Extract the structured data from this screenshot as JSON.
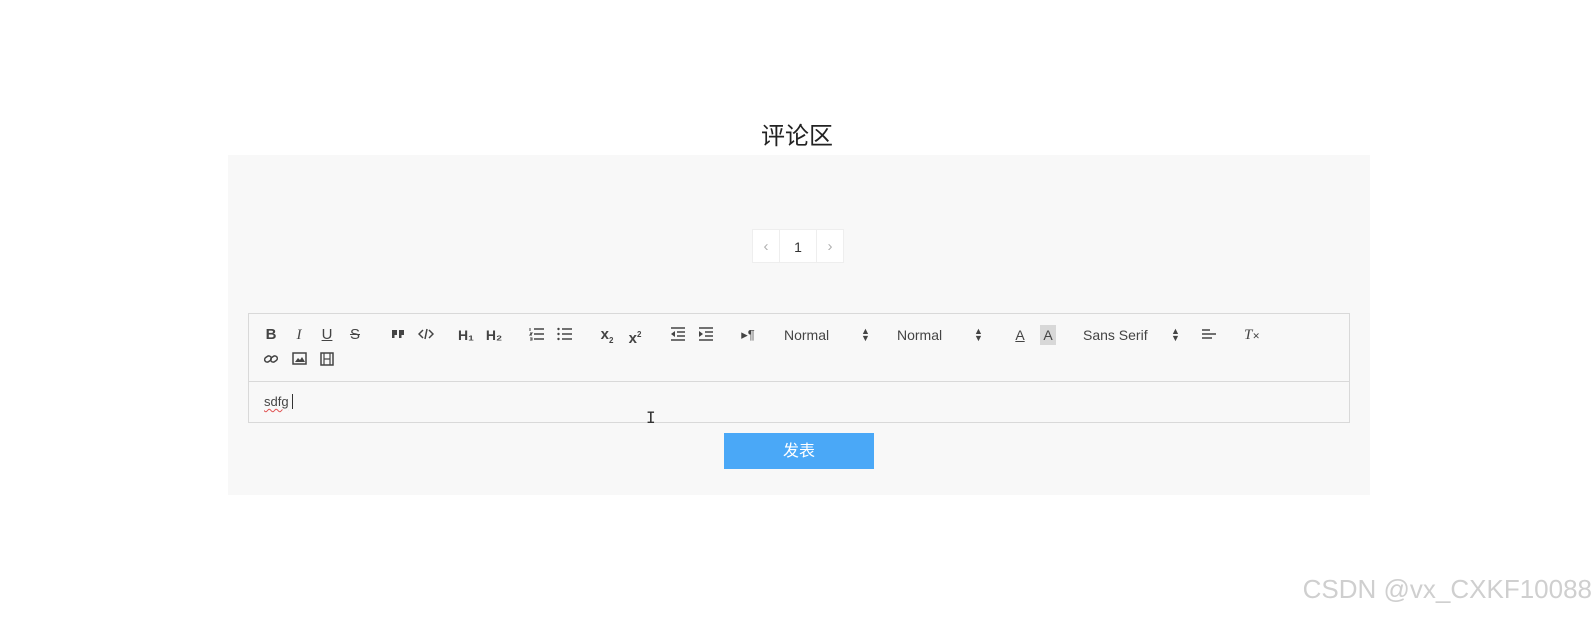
{
  "page": {
    "title": "评论区"
  },
  "pagination": {
    "prev": "‹",
    "current": "1",
    "next": "›"
  },
  "toolbar": {
    "bold": "B",
    "italic": "I",
    "underline": "U",
    "strike": "S",
    "h1": "H₁",
    "h2": "H₂",
    "subscript_base": "x",
    "subscript_mark": "2",
    "superscript_base": "x",
    "superscript_mark": "2",
    "direction": "▸¶",
    "size_picker": "Normal",
    "header_picker": "Normal",
    "color": "A",
    "background": "A",
    "font_picker": "Sans Serif",
    "clean": "T"
  },
  "editor": {
    "content": "sdfg"
  },
  "submit": {
    "label": "发表"
  },
  "watermark": "CSDN @vx_CXKF10088",
  "colors": {
    "accent": "#4aa8f7",
    "panel": "#f8f8f8",
    "border": "#d9d9d9"
  }
}
